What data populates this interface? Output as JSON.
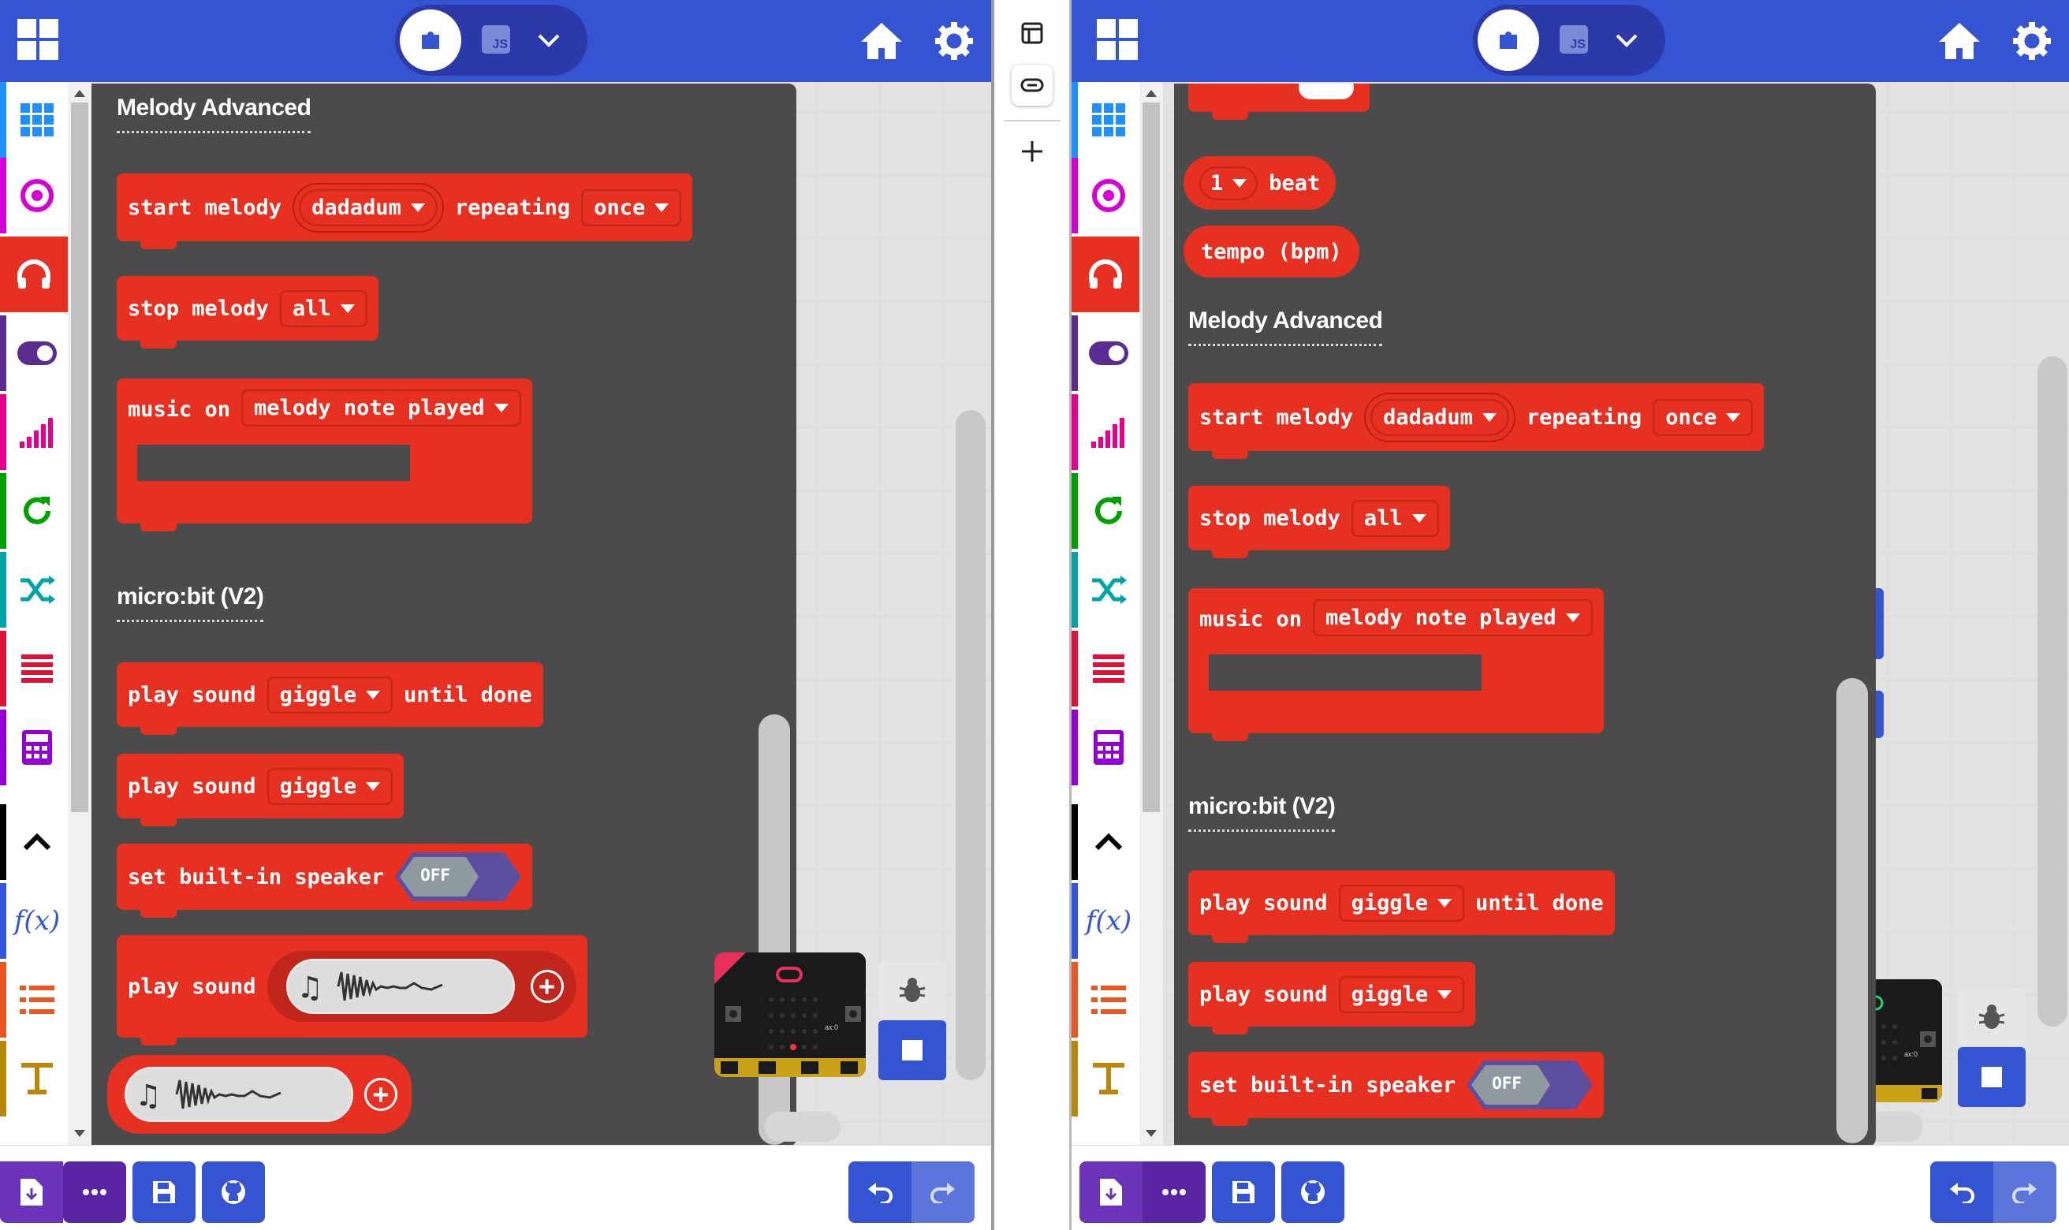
{
  "colors": {
    "topbar": "#3454d1",
    "flyout_bg": "#4b4b4b",
    "music_block": "#e63022",
    "bottom_primary": "#6b33b8",
    "bottom_blue": "#3454d1"
  },
  "editor_toggle": {
    "js_label": "JS"
  },
  "icons": [
    "microbit-logo-icon",
    "puzzle-icon",
    "js-icon",
    "chevron-down-icon",
    "home-icon",
    "gear-icon",
    "window-icon",
    "link-icon",
    "plus-icon"
  ],
  "categories": [
    {
      "name": "Basic",
      "icon": "grid-icon",
      "color": "#1e90ff"
    },
    {
      "name": "Input",
      "icon": "target-icon",
      "color": "#d400d4"
    },
    {
      "name": "Music",
      "icon": "headphones-icon",
      "color": "#e63022"
    },
    {
      "name": "Led",
      "icon": "toggle-icon",
      "color": "#5c2d91"
    },
    {
      "name": "Radio",
      "icon": "signal-icon",
      "color": "#e3008c"
    },
    {
      "name": "Loops",
      "icon": "refresh-icon",
      "color": "#00a000"
    },
    {
      "name": "Logic",
      "icon": "shuffle-icon",
      "color": "#00a4a6"
    },
    {
      "name": "Variables",
      "icon": "lines-icon",
      "color": "#dc143c"
    },
    {
      "name": "Math",
      "icon": "calculator-icon",
      "color": "#9400d3"
    },
    {
      "name": "Advanced",
      "icon": "chevron-up-icon",
      "color": "#000000"
    },
    {
      "name": "Functions",
      "icon": "function-icon",
      "color": "#3455db"
    },
    {
      "name": "Arrays",
      "icon": "list-icon",
      "color": "#e65722"
    },
    {
      "name": "Text",
      "icon": "text-icon",
      "color": "#b8860b"
    }
  ],
  "left": {
    "section_melody_advanced": "Melody Advanced",
    "section_microbit_v2": "micro:bit (V2)",
    "start_melody": {
      "label": "start melody",
      "melody": "dadadum",
      "repeat_label": "repeating",
      "repeat": "once"
    },
    "stop_melody": {
      "label": "stop melody",
      "value": "all"
    },
    "music_on": {
      "label": "music on",
      "event": "melody note played"
    },
    "play_sound_until": {
      "label": "play sound",
      "sound": "giggle",
      "suffix": "until done"
    },
    "play_sound": {
      "label": "play sound",
      "sound": "giggle"
    },
    "set_speaker": {
      "label": "set built-in speaker",
      "value": "OFF"
    },
    "play_sound_expr": {
      "label": "play sound"
    },
    "add_label": "+"
  },
  "right": {
    "beat_value": "1",
    "beat_label": "beat",
    "tempo_label": "tempo (bpm)",
    "section_melody_advanced": "Melody Advanced",
    "section_microbit_v2": "micro:bit (V2)",
    "start_melody": {
      "label": "start melody",
      "melody": "dadadum",
      "repeat_label": "repeating",
      "repeat": "once"
    },
    "stop_melody": {
      "label": "stop melody",
      "value": "all"
    },
    "music_on": {
      "label": "music on",
      "event": "melody note played"
    },
    "play_sound_until": {
      "label": "play sound",
      "sound": "giggle",
      "suffix": "until done"
    },
    "play_sound": {
      "label": "play sound",
      "sound": "giggle"
    },
    "set_speaker": {
      "label": "set built-in speaker",
      "value": "OFF"
    }
  },
  "simulator": {
    "temp_label": "ax:0"
  },
  "bottom_bar": [
    "download-icon",
    "more-icon",
    "save-icon",
    "github-icon",
    "undo-icon",
    "redo-icon"
  ]
}
